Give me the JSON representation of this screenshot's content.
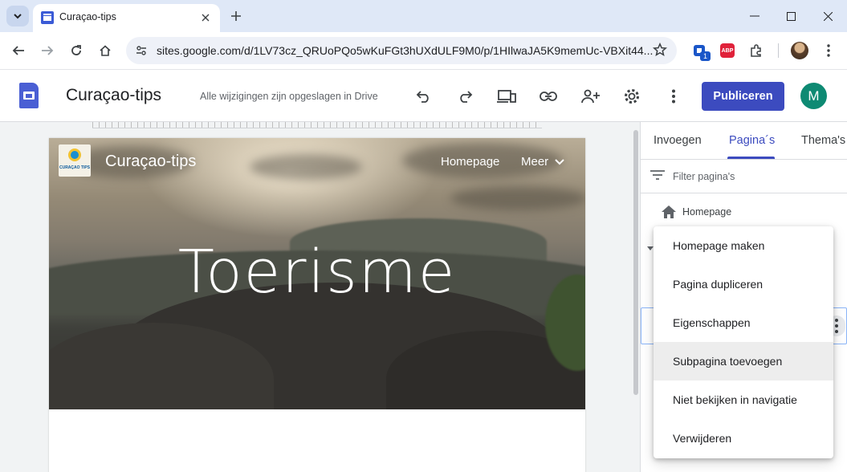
{
  "browser": {
    "tab_title": "Curaçao-tips",
    "url": "sites.google.com/d/1LV73cz_QRUoPQo5wKuFGt3hUXdULF9M0/p/1HIlwaJA5K9memUc-VBXit44...",
    "extension_badge": "1",
    "abp_label": "ABP"
  },
  "app": {
    "title": "Curaçao-tips",
    "save_status": "Alle wijzigingen zijn opgeslagen in Drive",
    "publish_label": "Publiceren",
    "avatar_letter": "M",
    "accent_color": "#3c4bbf",
    "avatar_color": "#0e8a73"
  },
  "site": {
    "logo_text": "CURAÇAO TIPS",
    "name": "Curaçao-tips",
    "nav": {
      "home": "Homepage",
      "more": "Meer"
    },
    "hero_title": "Toerisme"
  },
  "panel": {
    "tabs": [
      "Invoegen",
      "Pagina´s",
      "Thema's"
    ],
    "active_tab": "Pagina´s",
    "filter_placeholder": "Filter pagina's",
    "pages": {
      "home": "Homepage"
    }
  },
  "context_menu": {
    "items": [
      "Homepage maken",
      "Pagina dupliceren",
      "Eigenschappen",
      "Subpagina toevoegen",
      "Niet bekijken in navigatie",
      "Verwijderen"
    ],
    "hovered": "Subpagina toevoegen"
  },
  "icons": [
    "tab-search-icon",
    "close-icon",
    "plus-icon",
    "minimize-icon",
    "maximize-icon",
    "back-icon",
    "forward-icon",
    "reload-icon",
    "home-icon",
    "site-info-icon",
    "star-icon",
    "extensions-icon",
    "kebab-icon",
    "undo-icon",
    "redo-icon",
    "preview-icon",
    "link-icon",
    "share-icon",
    "settings-icon",
    "chevron-down-icon",
    "filter-icon",
    "house-icon"
  ]
}
